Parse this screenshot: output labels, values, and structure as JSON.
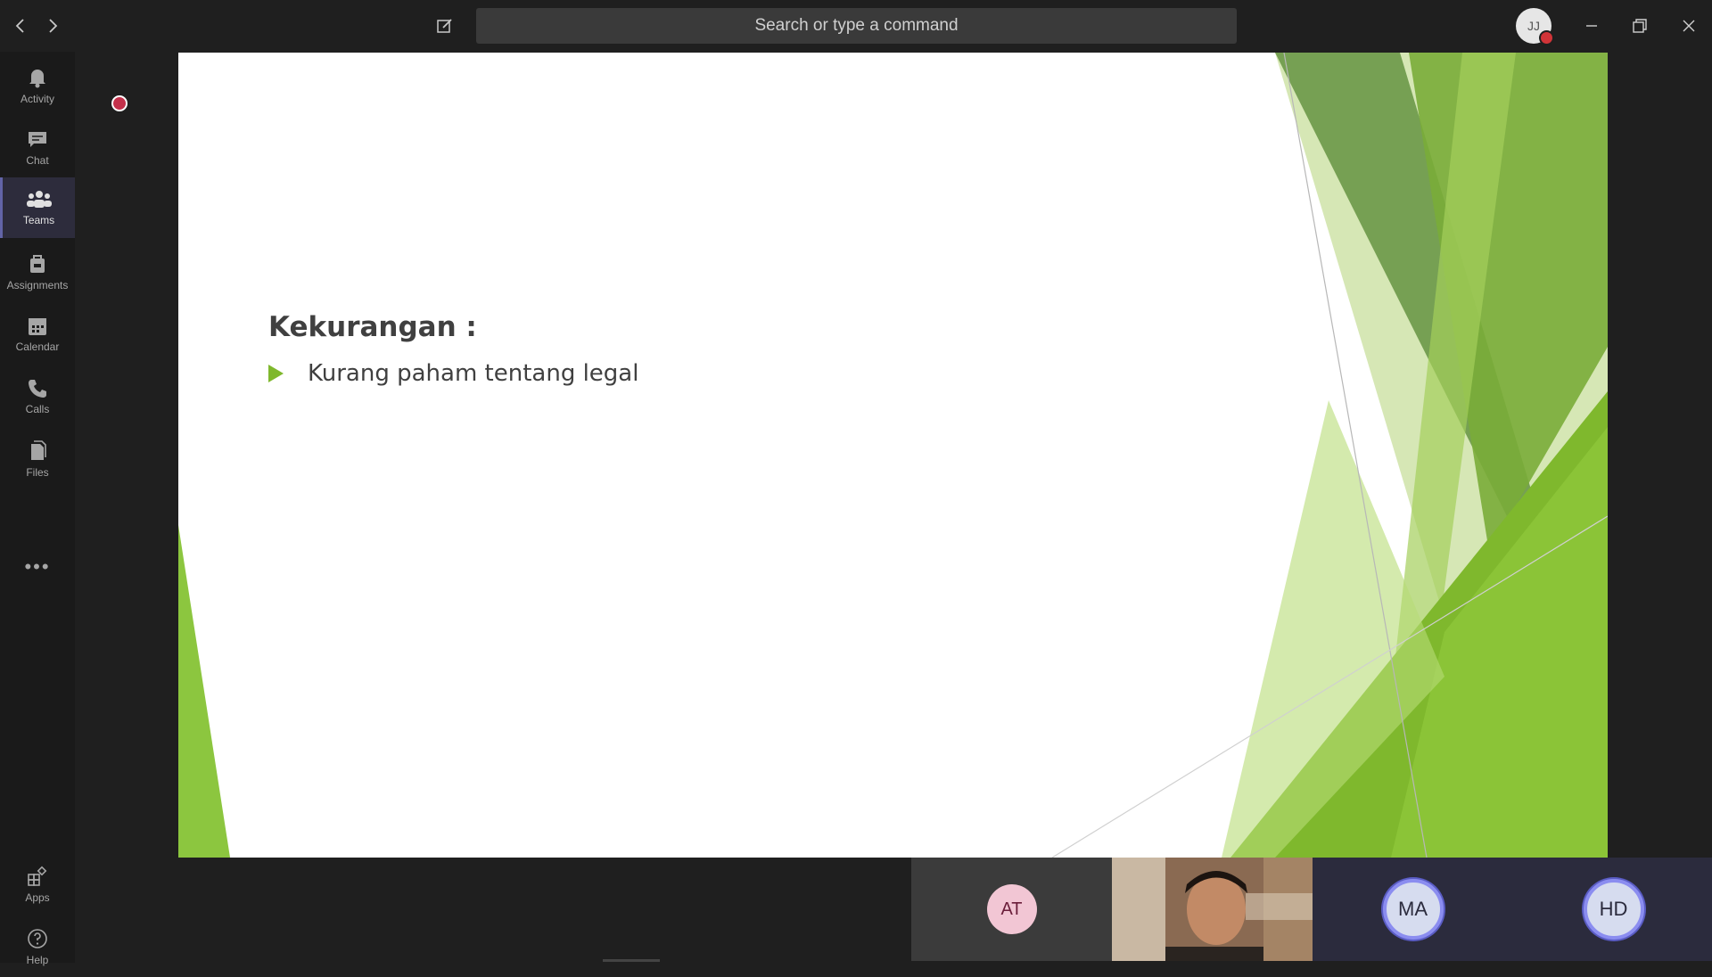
{
  "titlebar": {
    "search_placeholder": "Search or type a command",
    "user_initials": "JJ",
    "status_color": "#d13438"
  },
  "rail": {
    "items": [
      {
        "label": "Activity",
        "icon": "bell-icon"
      },
      {
        "label": "Chat",
        "icon": "chat-icon"
      },
      {
        "label": "Teams",
        "icon": "teams-icon",
        "active": true
      },
      {
        "label": "Assignments",
        "icon": "assignments-icon"
      },
      {
        "label": "Calendar",
        "icon": "calendar-icon"
      },
      {
        "label": "Calls",
        "icon": "phone-icon"
      },
      {
        "label": "Files",
        "icon": "files-icon"
      }
    ],
    "more": "•••",
    "bottom": [
      {
        "label": "Apps",
        "icon": "apps-icon"
      },
      {
        "label": "Help",
        "icon": "help-icon"
      }
    ]
  },
  "slide": {
    "title": "Kekurangan :",
    "bullets": [
      "Kurang paham tentang legal"
    ],
    "accent_color": "#7fb82d"
  },
  "participants": [
    {
      "initials": "AT"
    },
    {
      "initials": ""
    },
    {
      "initials": "MA"
    },
    {
      "initials": "HD"
    }
  ],
  "colors": {
    "accent": "#6264a7",
    "recording": "#c4314b"
  }
}
